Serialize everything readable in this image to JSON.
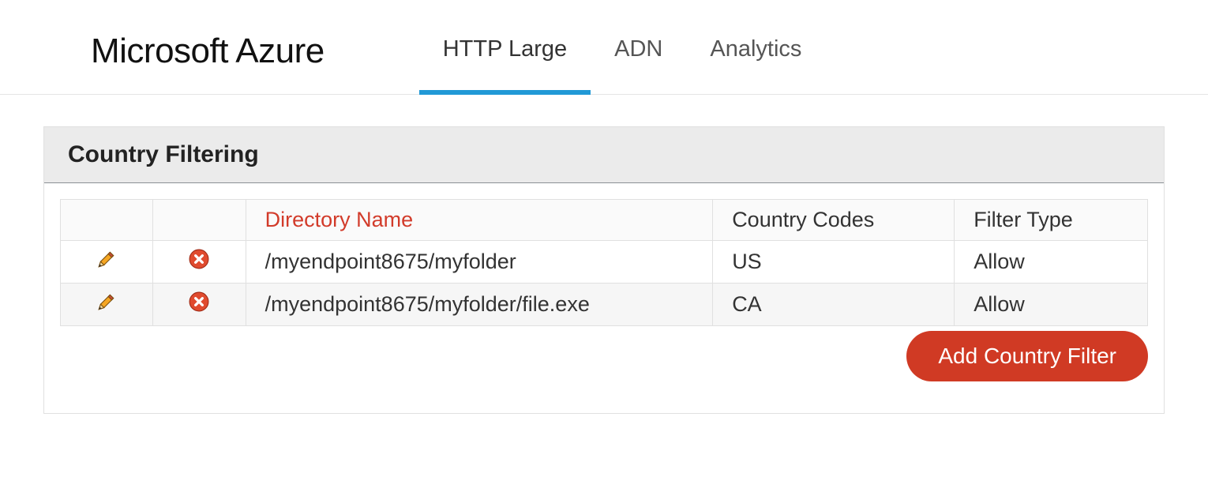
{
  "header": {
    "brand": "Microsoft Azure",
    "tabs": [
      {
        "label": "HTTP Large",
        "active": true
      },
      {
        "label": "ADN",
        "active": false
      },
      {
        "label": "Analytics",
        "active": false
      }
    ]
  },
  "panel": {
    "title": "Country Filtering",
    "columns": {
      "directory_name": "Directory Name",
      "country_codes": "Country Codes",
      "filter_type": "Filter Type"
    },
    "rows": [
      {
        "directory_name": "/myendpoint8675/myfolder",
        "country_codes": "US",
        "filter_type": "Allow"
      },
      {
        "directory_name": "/myendpoint8675/myfolder/file.exe",
        "country_codes": "CA",
        "filter_type": "Allow"
      }
    ],
    "add_button": "Add Country Filter"
  },
  "icons": {
    "edit": "edit-icon",
    "delete": "delete-icon"
  }
}
